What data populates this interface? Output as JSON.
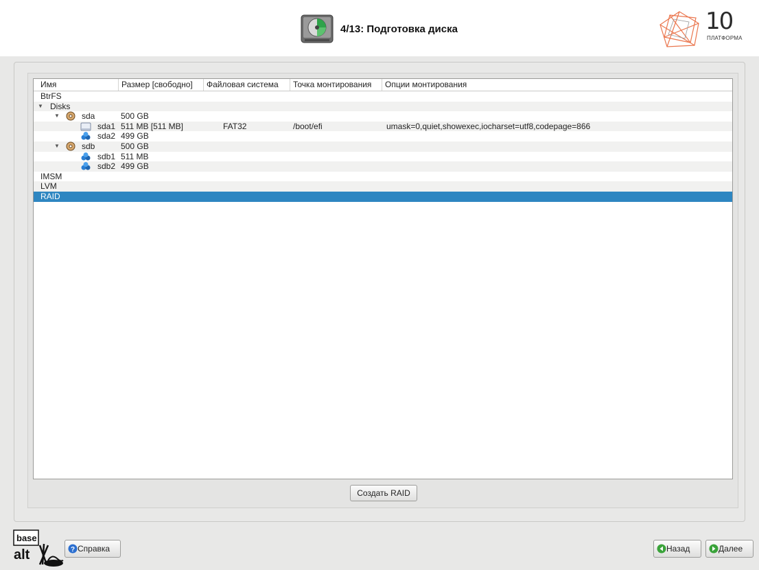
{
  "header": {
    "step_title": "4/13: Подготовка диска",
    "brand_number": "10",
    "brand_sub": "ПЛАТФОРМА"
  },
  "table": {
    "columns": [
      "Имя",
      "Размер [свободно]",
      "Файловая система",
      "Точка монтирования",
      "Опции монтирования"
    ],
    "rows": [
      {
        "name": "BtrFS",
        "size": "",
        "fs": "",
        "mount": "",
        "options": ""
      },
      {
        "name": "Disks",
        "size": "",
        "fs": "",
        "mount": "",
        "options": ""
      },
      {
        "name": "sda",
        "size": "500 GB",
        "fs": "",
        "mount": "",
        "options": ""
      },
      {
        "name": "sda1",
        "size": "511 MB [511 MB]",
        "fs": "FAT32",
        "mount": "/boot/efi",
        "options": "umask=0,quiet,showexec,iocharset=utf8,codepage=866"
      },
      {
        "name": "sda2",
        "size": "499 GB",
        "fs": "",
        "mount": "",
        "options": ""
      },
      {
        "name": "sdb",
        "size": "500 GB",
        "fs": "",
        "mount": "",
        "options": ""
      },
      {
        "name": "sdb1",
        "size": "511 MB",
        "fs": "",
        "mount": "",
        "options": ""
      },
      {
        "name": "sdb2",
        "size": "499 GB",
        "fs": "",
        "mount": "",
        "options": ""
      },
      {
        "name": "IMSM",
        "size": "",
        "fs": "",
        "mount": "",
        "options": ""
      },
      {
        "name": "LVM",
        "size": "",
        "fs": "",
        "mount": "",
        "options": ""
      },
      {
        "name": "RAID",
        "size": "",
        "fs": "",
        "mount": "",
        "options": ""
      }
    ],
    "selected_row": "RAID"
  },
  "buttons": {
    "create_raid": "Создать RAID",
    "help": "Справка",
    "back": "Назад",
    "next": "Далее"
  },
  "footer": {
    "logo_text_top": "base",
    "logo_text_bottom": "alt"
  },
  "colors": {
    "selection": "#2e86c1",
    "nav_green": "#3aa33a",
    "help_blue": "#2b6fd0"
  }
}
